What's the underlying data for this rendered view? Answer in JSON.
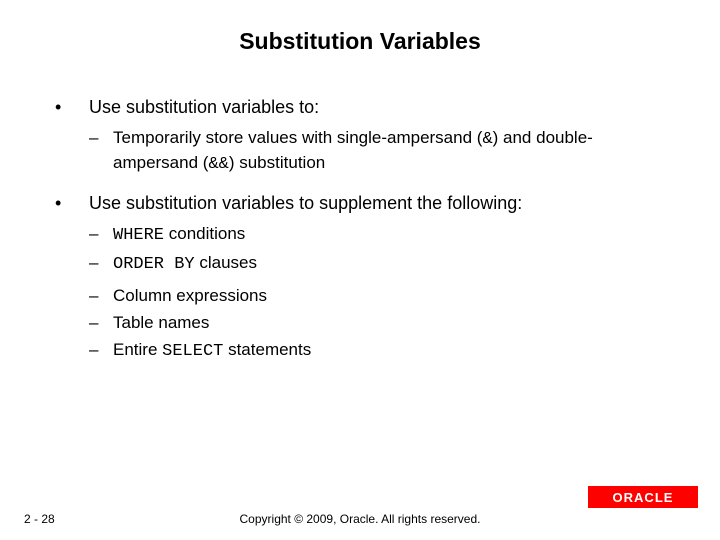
{
  "title": "Substitution Variables",
  "bullets": {
    "b1": {
      "text": "Use substitution variables to:",
      "sub1_pre": "Temporarily store values with single-ampersand (",
      "sub1_code1": "&",
      "sub1_mid": ") and double-ampersand (",
      "sub1_code2": "&&",
      "sub1_post": ") substitution"
    },
    "b2": {
      "text": "Use substitution variables to supplement the following:",
      "s1_code": "WHERE",
      "s1_rest": " conditions",
      "s2_code": "ORDER BY",
      "s2_rest": " clauses",
      "s3": "Column expressions",
      "s4": "Table names",
      "s5_pre": "Entire ",
      "s5_code": "SELECT",
      "s5_post": " statements"
    }
  },
  "footer": {
    "page": "2 - 28",
    "copyright": "Copyright © 2009, Oracle. All rights reserved."
  },
  "logo": "ORACLE",
  "glyph": {
    "bullet": "•",
    "dash": "–"
  }
}
